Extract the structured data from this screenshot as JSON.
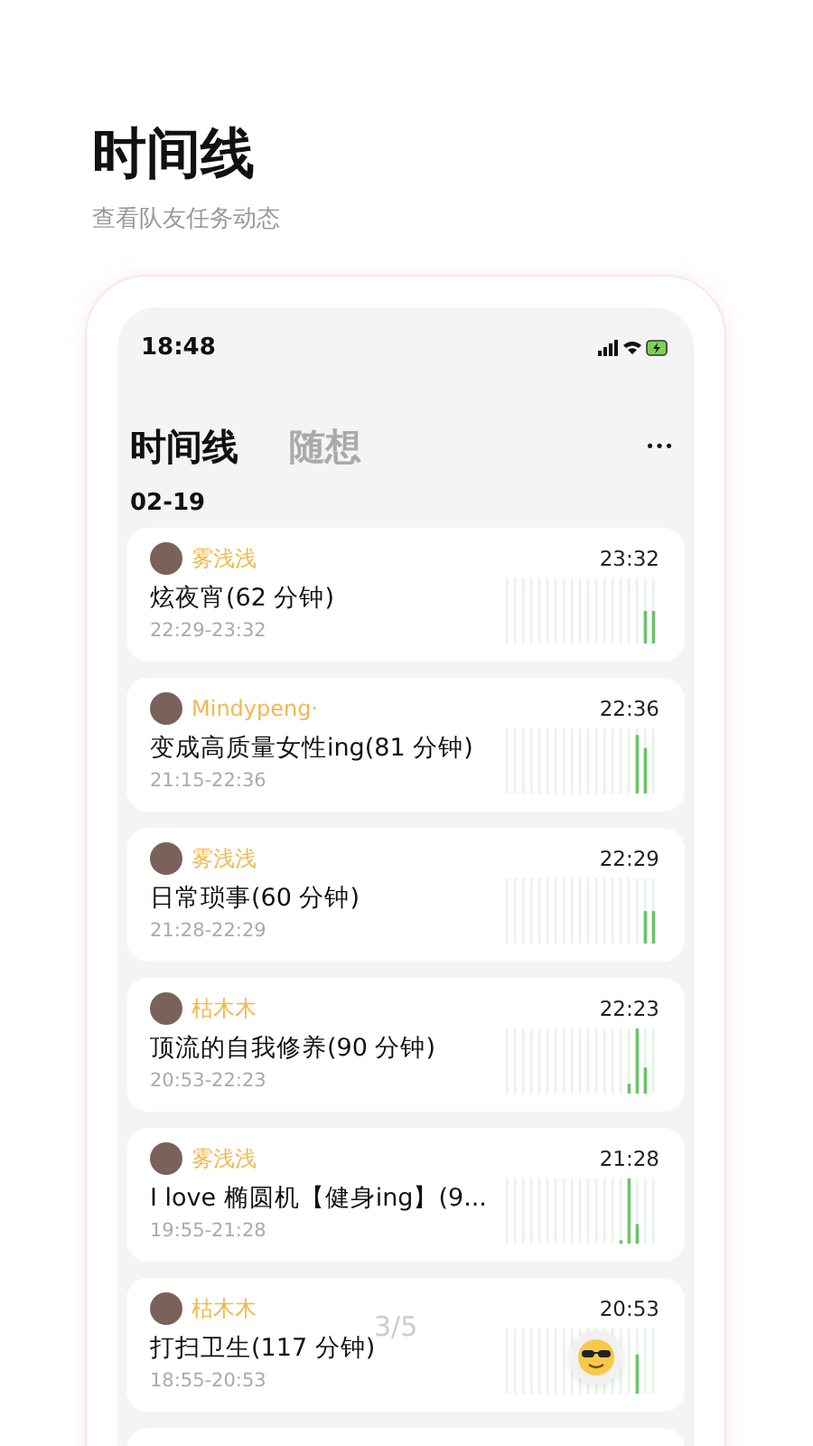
{
  "header": {
    "title": "时间线",
    "subtitle": "查看队友任务动态"
  },
  "phone": {
    "status_time": "18:48",
    "tabs": [
      {
        "label": "时间线",
        "selected": true
      },
      {
        "label": "随想",
        "selected": false
      }
    ],
    "more": "•••",
    "date": "02-19",
    "entries": [
      {
        "user": "雾浅浅",
        "time": "23:32",
        "title": "炫夜宵(62 分钟)",
        "range": "22:29-23:32"
      },
      {
        "user": "Mindypeng·",
        "time": "22:36",
        "title": "变成高质量女性ing(81 分钟)",
        "range": "21:15-22:36"
      },
      {
        "user": "雾浅浅",
        "time": "22:29",
        "title": "日常琐事(60 分钟)",
        "range": "21:28-22:29"
      },
      {
        "user": "枯木木",
        "time": "22:23",
        "title": "顶流的自我修养(90 分钟)",
        "range": "20:53-22:23"
      },
      {
        "user": "雾浅浅",
        "time": "21:28",
        "title": "I love 椭圆机【健身ing】(9...",
        "range": "19:55-21:28"
      },
      {
        "user": "枯木木",
        "time": "20:53",
        "title": "打扫卫生(117 分钟)",
        "range": "18:55-20:53"
      }
    ]
  },
  "pager": "3/5"
}
